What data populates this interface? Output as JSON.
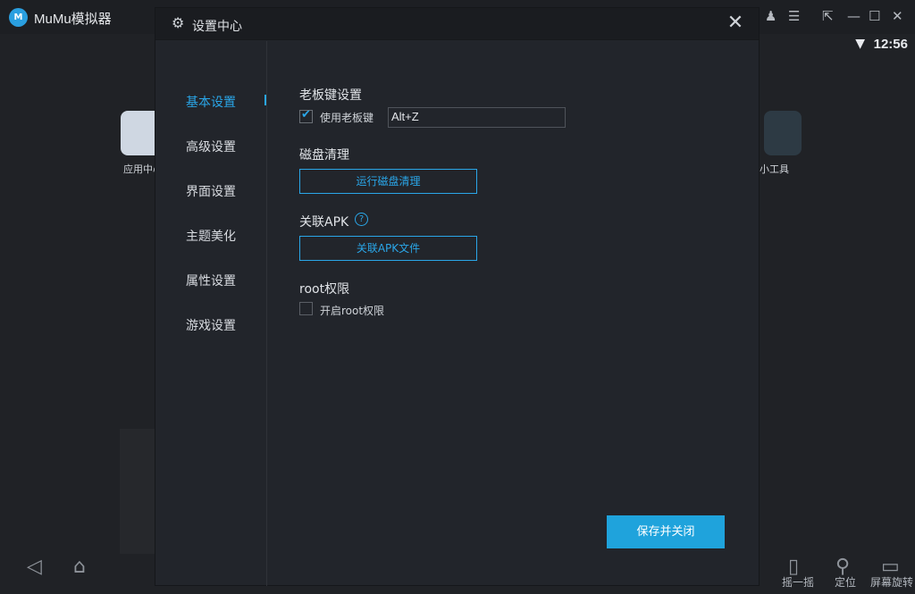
{
  "emulator": {
    "app_name": "MuMu模拟器",
    "logo_text": "M",
    "time": "12:56",
    "apps": [
      {
        "label": "应用中心"
      },
      {
        "label": "小工具"
      }
    ],
    "dock": [
      {
        "label": "摇一摇"
      },
      {
        "label": "定位"
      },
      {
        "label": "屏幕旋转"
      }
    ]
  },
  "dialog": {
    "title": "设置中心",
    "sidebar": {
      "items": [
        {
          "label": "基本设置"
        },
        {
          "label": "高级设置"
        },
        {
          "label": "界面设置"
        },
        {
          "label": "主题美化"
        },
        {
          "label": "属性设置"
        },
        {
          "label": "游戏设置"
        }
      ],
      "active_index": 0
    },
    "boss_key": {
      "section_title": "老板键设置",
      "checkbox_label": "使用老板键",
      "checked": true,
      "hotkey_value": "Alt+Z"
    },
    "disk_cleanup": {
      "section_title": "磁盘清理",
      "button_label": "运行磁盘清理"
    },
    "apk": {
      "section_title": "关联APK",
      "help_glyph": "?",
      "button_label": "关联APK文件"
    },
    "root": {
      "section_title": "root权限",
      "checkbox_label": "开启root权限",
      "checked": false
    },
    "save_button_label": "保存并关闭"
  },
  "colors": {
    "accent": "#2aa6e8",
    "primary_button": "#1fa3dc",
    "dialog_bg": "#22252b",
    "header_bg": "#1a1c20"
  }
}
